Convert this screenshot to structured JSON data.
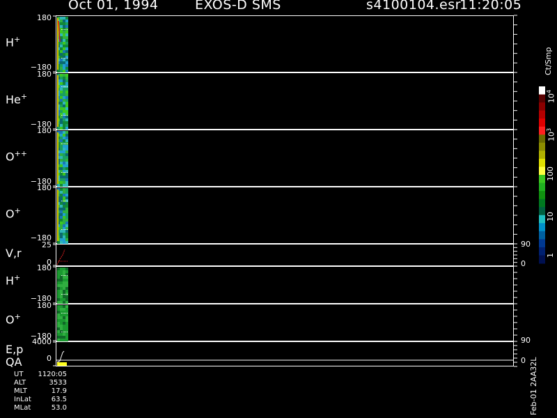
{
  "header": {
    "date": "Oct 01, 1994",
    "instrument": "EXOS-D SMS",
    "file": "s4100104.esr",
    "time": "11:20:05"
  },
  "panels": [
    {
      "id": "h-plus",
      "species": "H",
      "charge": "+",
      "top_tick": "180",
      "bottom_tick": "−180"
    },
    {
      "id": "he-plus",
      "species": "He",
      "charge": "+",
      "top_tick": "180",
      "bottom_tick": "−180"
    },
    {
      "id": "o-plusplus",
      "species": "O",
      "charge": "++",
      "top_tick": "180",
      "bottom_tick": "−180"
    },
    {
      "id": "o-plus",
      "species": "O",
      "charge": "+",
      "top_tick": "180",
      "bottom_tick": "−180"
    },
    {
      "id": "vr",
      "species": "V,r",
      "charge": "",
      "top_tick": "25",
      "bottom_tick": "0",
      "right_top": "90",
      "right_bottom": "0"
    },
    {
      "id": "h-plus-2",
      "species": "H",
      "charge": "+",
      "top_tick": "180",
      "bottom_tick": "−180"
    },
    {
      "id": "o-plus-2",
      "species": "O",
      "charge": "+",
      "top_tick": "180",
      "bottom_tick": "−180"
    },
    {
      "id": "ep-qa",
      "species": "E,p",
      "charge": "",
      "species2": "QA",
      "top_tick": "4000",
      "bottom_tick": "0",
      "right_top": "90",
      "right_bottom": "0"
    }
  ],
  "colorbar": {
    "unit": "Ct/Smp",
    "labels": [
      {
        "text": "10",
        "sup": "4",
        "value": 10000
      },
      {
        "text": "10",
        "sup": "3",
        "value": 1000
      },
      {
        "text": "100",
        "sup": "",
        "value": 100
      },
      {
        "text": "10",
        "sup": "",
        "value": 10
      },
      {
        "text": "1",
        "sup": "",
        "value": 1
      }
    ],
    "colors": [
      "#ffffff",
      "#5a0000",
      "#8b0000",
      "#b40000",
      "#e00000",
      "#ff2020",
      "#6b6b00",
      "#8c8c00",
      "#b0b000",
      "#e0e000",
      "#ffff40",
      "#3cc820",
      "#20b020",
      "#109010",
      "#007820",
      "#006040",
      "#20c0c0",
      "#0090c8",
      "#0060a0",
      "#003890",
      "#002070",
      "#001050"
    ]
  },
  "stats": [
    {
      "key": "UT",
      "value": "1120:05"
    },
    {
      "key": "ALT",
      "value": "3533"
    },
    {
      "key": "MLT",
      "value": "17.9"
    },
    {
      "key": "InLat",
      "value": "63.5"
    },
    {
      "key": "MLat",
      "value": "53.0"
    }
  ],
  "footer_id": "Feb-01 2AA32L",
  "chart_data": {
    "type": "heatmap",
    "title": "Oct 01, 1994   EXOS-D SMS   s4100104.esr  11:20:05",
    "panels": [
      "H+",
      "He+",
      "O++",
      "O+",
      "V,r",
      "H+",
      "O+",
      "E,p / QA"
    ],
    "ylim_angle": [
      -180,
      180
    ],
    "ylim_vr": [
      0,
      25
    ],
    "ylim_ep": [
      0,
      4000
    ],
    "colorbar_range": [
      1,
      10000
    ],
    "colorbar_scale": "log",
    "grid": false
  }
}
